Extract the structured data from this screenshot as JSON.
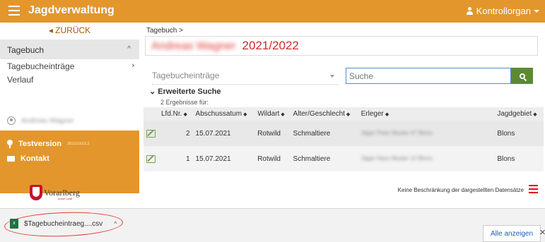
{
  "header": {
    "app_title": "Jagdverwaltung",
    "user_menu_label": "Kontrollorgan",
    "brand_color": "#e3962c"
  },
  "sidebar": {
    "back_label": "ZURÜCK",
    "section_label": "Tagebuch",
    "items": [
      {
        "label": "Tagebucheinträge"
      },
      {
        "label": "Verlauf"
      }
    ],
    "user_name": "Andreas Wagner",
    "orange_items": [
      {
        "label": "Testversion",
        "tag": "20210323.2"
      },
      {
        "label": "Kontakt"
      }
    ],
    "logo_text": "Vorarlberg",
    "logo_sub": "unser Land"
  },
  "main": {
    "breadcrumb": "Tagebuch >",
    "title_name": "Andreas Wagner",
    "title_year": "2021/2022",
    "search_select_value": "Tagebucheinträge",
    "search_placeholder": "Suche",
    "advanced_search_label": "Erweiterte Suche",
    "results_label": "2 Ergebnisse für:",
    "table": {
      "columns": [
        "",
        "Lfd.Nr.",
        "Abschussatum",
        "Wildart",
        "Alter/Geschlecht",
        "Erleger",
        "Jagdgebiet"
      ],
      "rows": [
        {
          "nr": "2",
          "datum": "15.07.2021",
          "wildart": "Rotwild",
          "alter": "Schmaltiere",
          "erleger": "Jäger Peter Muster 47 Blons",
          "jagdgebiet": "Blons"
        },
        {
          "nr": "1",
          "datum": "15.07.2021",
          "wildart": "Rotwild",
          "alter": "Schmaltiere",
          "erleger": "Jäger Hans Muster 12 Blons",
          "jagdgebiet": "Blons"
        }
      ]
    },
    "footer_note": "Keine Beschränkung der dargestellten Datensätze"
  },
  "download_bar": {
    "file_name": "$Tagebucheintraeg....csv",
    "file_type": "csv",
    "show_all_label": "Alle anzeigen",
    "close_label": "✕"
  }
}
